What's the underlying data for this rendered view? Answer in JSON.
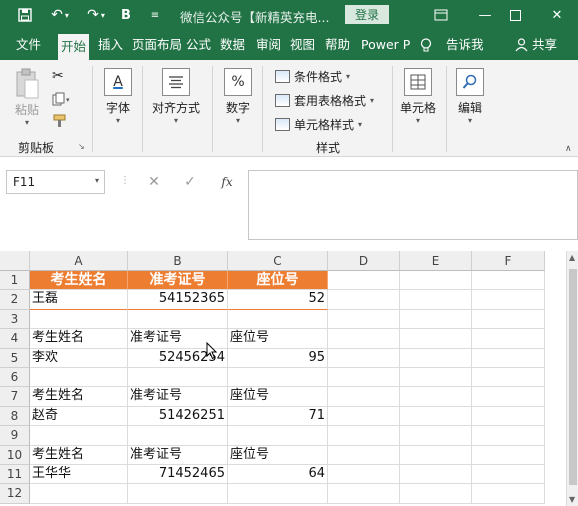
{
  "titlebar": {
    "bold_btn": "B",
    "title": "微信公众号【新精英充电...",
    "login": "登录"
  },
  "tabs": [
    {
      "label": "文件"
    },
    {
      "label": "开始"
    },
    {
      "label": "插入"
    },
    {
      "label": "页面布局"
    },
    {
      "label": "公式"
    },
    {
      "label": "数据"
    },
    {
      "label": "审阅"
    },
    {
      "label": "视图"
    },
    {
      "label": "帮助"
    },
    {
      "label": "Power P"
    },
    {
      "label": "告诉我"
    },
    {
      "label": "共享"
    }
  ],
  "ribbon": {
    "paste": "粘贴",
    "clipboard_group": "剪贴板",
    "font": "字体",
    "font_icon": "A",
    "align": "对齐方式",
    "number": "数字",
    "number_icon": "%",
    "cond_format": "条件格式",
    "table_format": "套用表格格式",
    "cell_style": "单元格样式",
    "styles_group": "样式",
    "cells": "单元格",
    "edit": "编辑"
  },
  "formula_bar": {
    "name_box": "F11",
    "cancel": "✕",
    "confirm": "✓",
    "fx": "fx",
    "value": ""
  },
  "sheet": {
    "columns": [
      "A",
      "B",
      "C",
      "D",
      "E",
      "F"
    ],
    "rows": [
      [
        "考生姓名",
        "准考证号",
        "座位号"
      ],
      [
        "王磊",
        "54152365",
        "52"
      ],
      [
        "",
        "",
        ""
      ],
      [
        "考生姓名",
        "准考证号",
        "座位号"
      ],
      [
        "李欢",
        "52456254",
        "95"
      ],
      [
        "",
        "",
        ""
      ],
      [
        "考生姓名",
        "准考证号",
        "座位号"
      ],
      [
        "赵奇",
        "51426251",
        "71"
      ],
      [
        "",
        "",
        ""
      ],
      [
        "考生姓名",
        "准考证号",
        "座位号"
      ],
      [
        "王华华",
        "71452465",
        "64"
      ],
      [
        "",
        "",
        ""
      ]
    ],
    "row_numbers": [
      "1",
      "2",
      "3",
      "4",
      "5",
      "6",
      "7",
      "8",
      "9",
      "10",
      "11",
      "12"
    ],
    "header_color": "#ED7D31"
  }
}
